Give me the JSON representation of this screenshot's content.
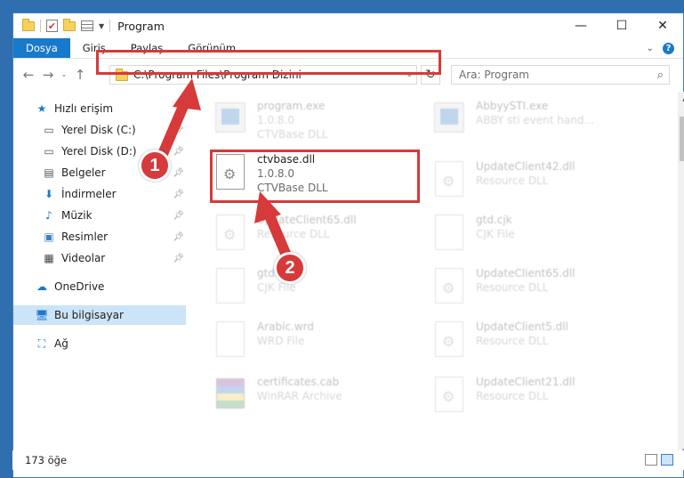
{
  "window": {
    "title": "Program",
    "minimize": "—",
    "maximize": "☐",
    "close": "✕"
  },
  "ribbon": {
    "tabs": [
      "Dosya",
      "Giriş",
      "Paylaş",
      "Görünüm"
    ],
    "expand": "⌄",
    "help": "?"
  },
  "address": {
    "path": "C:\\Program Files\\Program Dizini",
    "search_placeholder": "Ara: Program"
  },
  "nav": {
    "back": "←",
    "forward": "→",
    "recent": "⌄",
    "up": "↑",
    "refresh": "↻",
    "search_icon": "⌕"
  },
  "sidebar": {
    "items": [
      {
        "label": "Hızlı erişim",
        "icon": "star-icon"
      },
      {
        "label": "Yerel Disk (C:)",
        "icon": "drive-icon",
        "pinned": true
      },
      {
        "label": "Yerel Disk (D:)",
        "icon": "drive-icon",
        "pinned": true
      },
      {
        "label": "Belgeler",
        "icon": "documents-icon",
        "pinned": true
      },
      {
        "label": "İndirmeler",
        "icon": "download-icon",
        "pinned": true
      },
      {
        "label": "Müzik",
        "icon": "music-icon",
        "pinned": true
      },
      {
        "label": "Resimler",
        "icon": "pictures-icon",
        "pinned": true
      },
      {
        "label": "Videolar",
        "icon": "videos-icon",
        "pinned": true
      },
      {
        "label": "OneDrive",
        "icon": "cloud-icon"
      },
      {
        "label": "Bu bilgisayar",
        "icon": "computer-icon",
        "selected": true
      },
      {
        "label": "Ağ",
        "icon": "network-icon"
      }
    ]
  },
  "files": {
    "highlighted": {
      "name": "ctvbase.dll",
      "version": "1.0.8.0",
      "desc": "CTVBase DLL"
    },
    "faded": [
      {
        "name": "program.exe",
        "line2": "1.0.8.0",
        "line3": "CTVBase DLL"
      },
      {
        "name": "AbbyySTI.exe",
        "line2": "ABBY sti event hand...",
        "line3": ""
      },
      {
        "name": "UpdateClient42.dll",
        "line2": "Resource DLL",
        "line3": ""
      },
      {
        "name": "UpdateClient65.dll",
        "line2": "Resource DLL",
        "line3": ""
      },
      {
        "name": "gtd.cjk",
        "line2": "CJK File",
        "line3": ""
      },
      {
        "name": "gtd.cjk",
        "line2": "CJK File",
        "line3": ""
      },
      {
        "name": "UpdateClient65.dll",
        "line2": "Resource DLL",
        "line3": ""
      },
      {
        "name": "Arabic.wrd",
        "line2": "WRD File",
        "line3": ""
      },
      {
        "name": "UpdateClient5.dll",
        "line2": "Resource DLL",
        "line3": ""
      },
      {
        "name": "certificates.cab",
        "line2": "WinRAR Archive",
        "line3": ""
      },
      {
        "name": "UpdateClient21.dll",
        "line2": "Resource DLL",
        "line3": ""
      }
    ]
  },
  "status": {
    "count": "173 öğe"
  },
  "callouts": [
    "1",
    "2"
  ],
  "colors": {
    "accent": "#1979ca",
    "highlight_red": "#d63a3a",
    "selected_bg": "#cce4f7"
  }
}
